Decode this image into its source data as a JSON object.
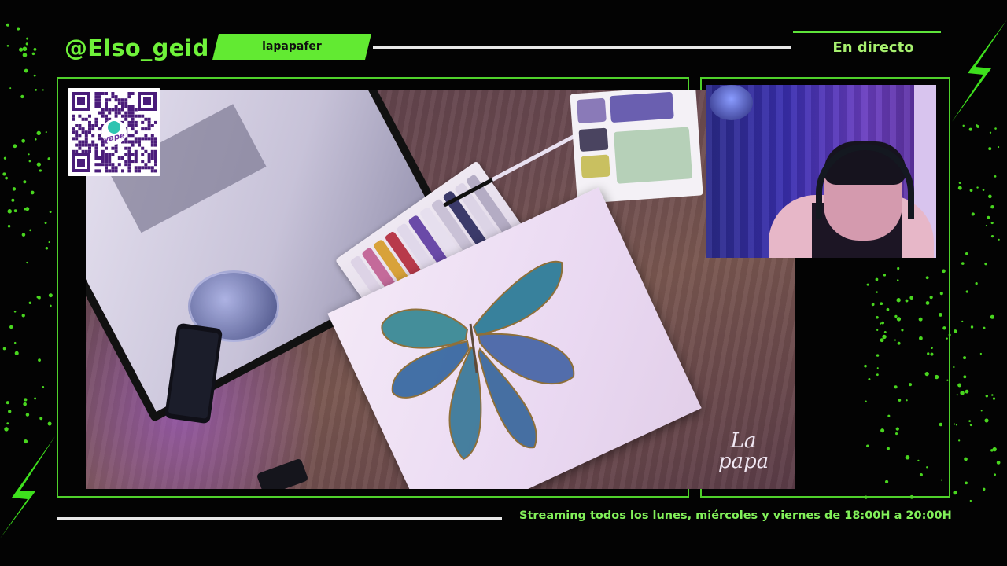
{
  "header": {
    "handle": "@Elso_geid",
    "tag": "lapapafer",
    "live_label": "En directo"
  },
  "footer": {
    "schedule": "Streaming todos los lunes, miércoles y viernes de 18:00H a 20:00H"
  },
  "overlay": {
    "qr_caption": "yape",
    "watermark_line1": "La",
    "watermark_line2": "papa"
  },
  "colors": {
    "accent_green": "#5ee33a",
    "background": "#030303"
  },
  "icons": [
    "lightning-bolt-icon",
    "qr-code-icon"
  ]
}
